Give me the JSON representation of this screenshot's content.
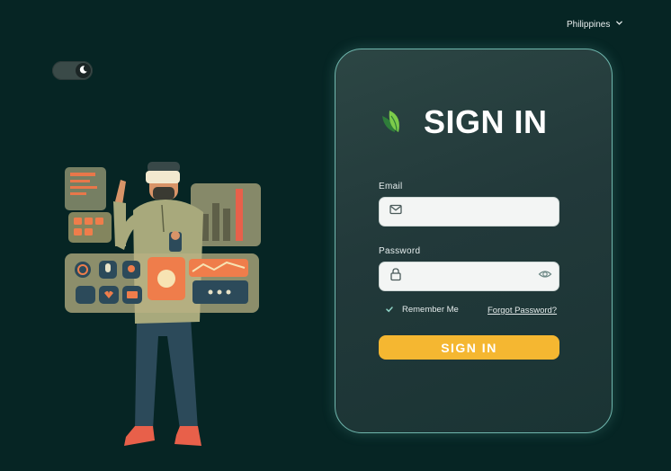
{
  "header": {
    "country": "Philippines",
    "country_icon": "chevron-down-icon"
  },
  "theme_toggle": {
    "state": "dark",
    "icon": "moon-icon"
  },
  "illustration": {
    "description_icon": "vr-user-illustration"
  },
  "signin_card": {
    "title": "SIGN IN",
    "logo_icon": "leaf-logo-icon",
    "email": {
      "label": "Email",
      "value": "",
      "placeholder": "",
      "icon": "mail-icon"
    },
    "password": {
      "label": "Password",
      "value": "",
      "placeholder": "",
      "icon": "lock-icon",
      "toggle_icon": "eye-icon"
    },
    "remember_label": "Remember Me",
    "remember_checked": true,
    "forgot_label": "Forgot Password?",
    "submit_label": "SIGN IN"
  },
  "colors": {
    "background": "#062524",
    "card_border": "#6fb6ad",
    "accent": "#f5b731",
    "leaf_light": "#7ccb4a",
    "leaf_dark": "#2f7d3a"
  }
}
